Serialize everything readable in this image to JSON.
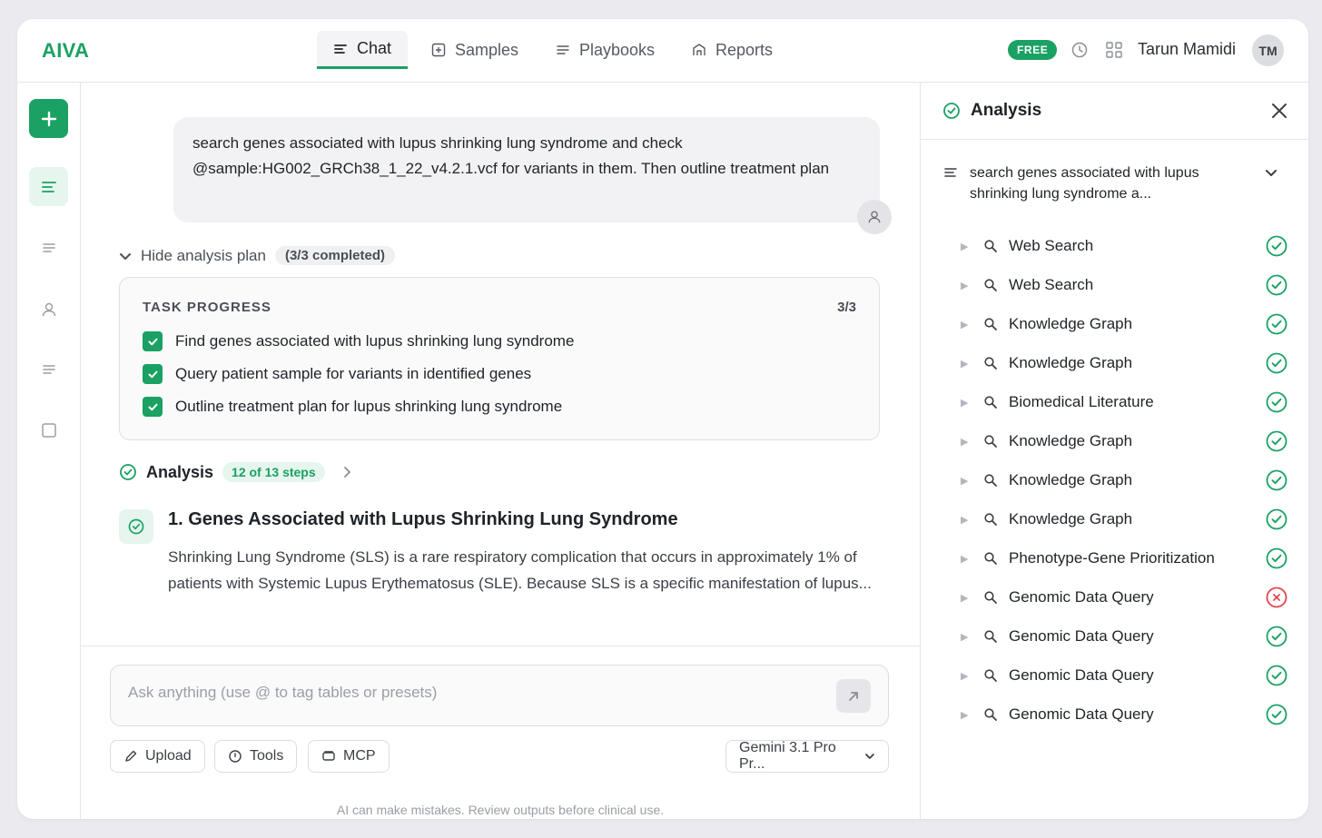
{
  "header": {
    "logo": "AIVA",
    "tabs": [
      {
        "label": "Chat"
      },
      {
        "label": "Samples"
      },
      {
        "label": "Playbooks"
      },
      {
        "label": "Reports"
      }
    ],
    "plan_badge": "FREE",
    "user_name": "Tarun Mamidi",
    "avatar_initials": "TM"
  },
  "chat": {
    "user_message": "search genes associated with lupus shrinking lung syndrome and check @sample:HG002_GRCh38_1_22_v4.2.1.vcf for variants in them. Then outline treatment plan",
    "plan_toggle_label": "Hide analysis plan",
    "plan_count": "(3/3 completed)",
    "task_progress": {
      "title": "TASK PROGRESS",
      "count": "3/3",
      "tasks": [
        {
          "label": "Find genes associated with lupus shrinking lung syndrome",
          "done": true
        },
        {
          "label": "Query patient sample for variants in identified genes",
          "done": true
        },
        {
          "label": "Outline treatment plan for lupus shrinking lung syndrome",
          "done": true
        }
      ]
    },
    "analysis_label": "Analysis",
    "analysis_steps": "12 of 13 steps",
    "step": {
      "title": "1. Genes Associated with Lupus Shrinking Lung Syndrome",
      "body": "Shrinking Lung Syndrome (SLS) is a rare respiratory complication that occurs in approximately 1% of patients with Systemic Lupus Erythematosus (SLE). Because SLS is a specific manifestation of lupus..."
    }
  },
  "composer": {
    "placeholder": "Ask anything (use @ to tag tables or presets)",
    "value": "",
    "upload_label": "Upload",
    "tools_label": "Tools",
    "mcp_label": "MCP",
    "model_label": "Gemini 3.1 Pro Pr...",
    "disclaimer": "AI can make mistakes. Review outputs before clinical use."
  },
  "panel": {
    "title": "Analysis",
    "query": "search genes associated with lupus shrinking lung syndrome a...",
    "tools": [
      {
        "name": "Web Search",
        "status": "success"
      },
      {
        "name": "Web Search",
        "status": "success"
      },
      {
        "name": "Knowledge Graph",
        "status": "success"
      },
      {
        "name": "Knowledge Graph",
        "status": "success"
      },
      {
        "name": "Biomedical Literature",
        "status": "success"
      },
      {
        "name": "Knowledge Graph",
        "status": "success"
      },
      {
        "name": "Knowledge Graph",
        "status": "success"
      },
      {
        "name": "Knowledge Graph",
        "status": "success"
      },
      {
        "name": "Phenotype-Gene Prioritization",
        "status": "success"
      },
      {
        "name": "Genomic Data Query",
        "status": "error"
      },
      {
        "name": "Genomic Data Query",
        "status": "success"
      },
      {
        "name": "Genomic Data Query",
        "status": "success"
      },
      {
        "name": "Genomic Data Query",
        "status": "success"
      }
    ]
  },
  "colors": {
    "accent": "#1aa163",
    "error": "#e0484f"
  }
}
